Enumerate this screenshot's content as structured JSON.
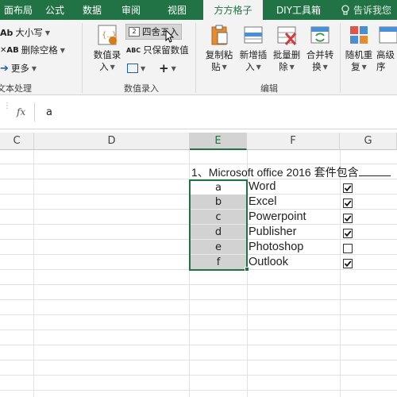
{
  "tabs": [
    {
      "label": "页面布局",
      "shown": "面布局",
      "active": false
    },
    {
      "label": "公式",
      "shown": "公式",
      "active": false
    },
    {
      "label": "数据",
      "shown": "数据",
      "active": false
    },
    {
      "label": "审阅",
      "shown": "审阅",
      "active": false
    },
    {
      "label": "视图",
      "shown": "视图",
      "active": false
    },
    {
      "label": "方方格子",
      "shown": "方方格子",
      "active": true
    },
    {
      "label": "DIY工具箱",
      "shown": "DIY工具箱",
      "active": false
    }
  ],
  "tell_me": "告诉我您",
  "ribbon": {
    "text_group": {
      "case_btn": "大小写",
      "remove_space_btn": "删除空格",
      "more_btn": "更多",
      "label": "文本处理"
    },
    "value_group": {
      "value_entry_btn_l1": "数值录",
      "value_entry_btn_l2": "入",
      "round_btn": "四舍五入",
      "keep_values_btn": "只保留数值",
      "plus_btn": "+",
      "label": "数值录入"
    },
    "edit_group": {
      "copy_paste_l1": "复制粘",
      "copy_paste_l2": "贴",
      "insert_l1": "新增插",
      "insert_l2": "入",
      "batch_delete_l1": "批量删",
      "batch_delete_l2": "除",
      "merge_l1": "合并转",
      "merge_l2": "换",
      "label": "编辑"
    },
    "random_group": {
      "random_l1": "随机重",
      "random_l2": "复",
      "advanced_l1": "高级",
      "advanced_l2": "序"
    }
  },
  "formula_bar": {
    "fx": "fx",
    "content": "a"
  },
  "columns": [
    "C",
    "D",
    "E",
    "F",
    "G"
  ],
  "sheet": {
    "title": "1、Microsoft office 2016 套件包含",
    "rows": [
      {
        "letter": "a",
        "app": "Word",
        "checked": true
      },
      {
        "letter": "b",
        "app": "Excel",
        "checked": true
      },
      {
        "letter": "c",
        "app": "Powerpoint",
        "checked": true
      },
      {
        "letter": "d",
        "app": "Publisher",
        "checked": true
      },
      {
        "letter": "e",
        "app": "Photoshop",
        "checked": false
      },
      {
        "letter": "f",
        "app": "Outlook",
        "checked": true
      }
    ]
  },
  "colors": {
    "excel_green": "#217346",
    "ribbon_bg": "#f3f3f3",
    "selected_fill": "#d2d2d2"
  }
}
